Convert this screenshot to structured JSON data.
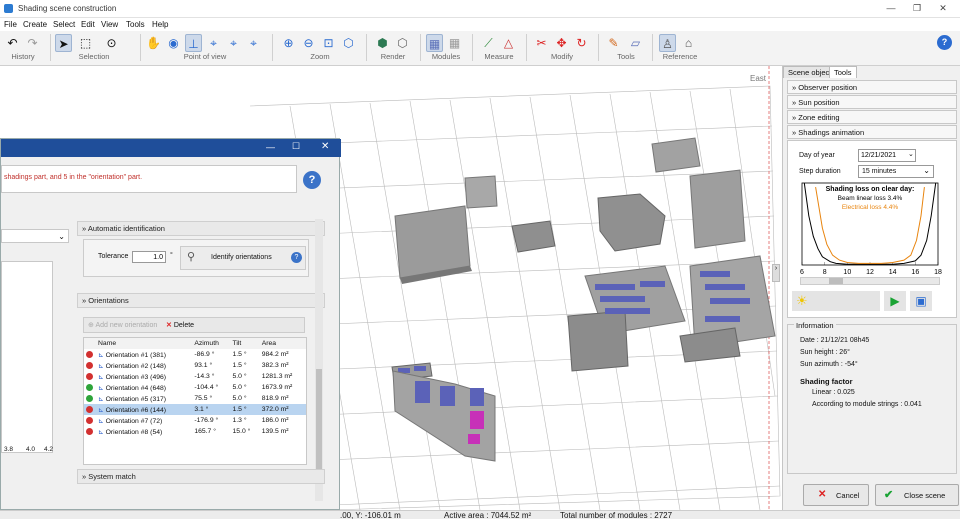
{
  "window": {
    "title": "Shading scene construction"
  },
  "menu": [
    "File",
    "Create",
    "Select",
    "Edit",
    "View",
    "Tools",
    "Help"
  ],
  "toolbar": {
    "groups": [
      "History",
      "Selection",
      "Point of view",
      "Zoom",
      "Render",
      "Modules",
      "Measure",
      "Modify",
      "Tools",
      "Reference"
    ]
  },
  "viewport": {
    "compass": "East"
  },
  "dialog": {
    "message": "shadings part, and 5 in the \"orientation\" part.",
    "auto_title": "Automatic identification",
    "tolerance_label": "Tolerance",
    "tolerance_value": "1.0",
    "tolerance_unit": "°",
    "identify_label": "Identify orientations",
    "orientations_title": "Orientations",
    "add_label": "Add new orientation",
    "delete_label": "Delete",
    "columns": [
      "Name",
      "Azimuth",
      "Tilt",
      "Area"
    ],
    "rows": [
      {
        "status": "red",
        "name": "Orientation #1 (381)",
        "azimuth": "-86.9 °",
        "tilt": "1.5 °",
        "area": "984.2 m²"
      },
      {
        "status": "red",
        "name": "Orientation #2 (148)",
        "azimuth": "93.1 °",
        "tilt": "1.5 °",
        "area": "382.3 m²"
      },
      {
        "status": "red",
        "name": "Orientation #3 (496)",
        "azimuth": "-14.3 °",
        "tilt": "5.0 °",
        "area": "1281.3 m²"
      },
      {
        "status": "green",
        "name": "Orientation #4 (648)",
        "azimuth": "-104.4 °",
        "tilt": "5.0 °",
        "area": "1673.9 m²"
      },
      {
        "status": "green",
        "name": "Orientation #5 (317)",
        "azimuth": "75.5 °",
        "tilt": "5.0 °",
        "area": "818.9 m²"
      },
      {
        "status": "red",
        "name": "Orientation #6 (144)",
        "azimuth": "3.1 °",
        "tilt": "1.5 °",
        "area": "372.0 m²"
      },
      {
        "status": "red",
        "name": "Orientation #7 (72)",
        "azimuth": "-176.9 °",
        "tilt": "1.3 °",
        "area": "186.0 m²"
      },
      {
        "status": "red",
        "name": "Orientation #8 (54)",
        "azimuth": "165.7 °",
        "tilt": "15.0 °",
        "area": "139.5 m²"
      }
    ],
    "system_match": "System match",
    "axis_ticks": [
      "3.8",
      "4.0",
      "4.2"
    ]
  },
  "right": {
    "tabs": [
      "Scene objects",
      "Tools"
    ],
    "sections": [
      "Observer position",
      "Sun position",
      "Zone editing",
      "Shadings animation"
    ],
    "day_label": "Day of year",
    "day_value": "12/21/2021",
    "step_label": "Step duration",
    "step_value": "15 minutes",
    "chart_title": "Shading loss on clear day:",
    "beam_loss": "Beam linear loss 3.4%",
    "elec_loss": "Electrical loss 4.4%",
    "info_title": "Information",
    "date": "Date : 21/12/21 08h45",
    "sun_height": "Sun height : 26°",
    "sun_azimuth": "Sun azimuth : -54°",
    "shading_title": "Shading factor",
    "linear": "Linear : 0.025",
    "strings": "According to module strings : 0.041",
    "cancel": "Cancel",
    "close": "Close scene"
  },
  "status": {
    "coords": ".00, Y: -106.01 m",
    "active_area": "Active area : 7044.52 m²",
    "modules": "Total number of modules : 2727"
  },
  "chart_data": {
    "type": "line",
    "title": "Shading loss on clear day:",
    "x_ticks": [
      6,
      8,
      10,
      12,
      14,
      16,
      18
    ],
    "xlim": [
      6,
      18
    ],
    "series": [
      {
        "name": "Beam linear loss 3.4%",
        "color": "#000000",
        "x": [
          6.2,
          6.6,
          7,
          7.4,
          7.8,
          8.5,
          9,
          10,
          11,
          12,
          13,
          14,
          15,
          16,
          16.5,
          17,
          17.4,
          17.8
        ],
        "y": [
          1.0,
          0.6,
          0.35,
          0.2,
          0.1,
          0.04,
          0.02,
          0.01,
          0.01,
          0.01,
          0.01,
          0.01,
          0.02,
          0.05,
          0.12,
          0.3,
          0.6,
          1.0
        ]
      },
      {
        "name": "Electrical loss 4.4%",
        "color": "#e8840e",
        "x": [
          7.2,
          7.5,
          7.8,
          8.2,
          8.7,
          9.3,
          10,
          11,
          12,
          13,
          14,
          15,
          15.6,
          16.1,
          16.5,
          16.8
        ],
        "y": [
          0.95,
          0.7,
          0.45,
          0.25,
          0.12,
          0.06,
          0.03,
          0.02,
          0.02,
          0.02,
          0.03,
          0.06,
          0.12,
          0.3,
          0.6,
          0.95
        ]
      }
    ]
  }
}
